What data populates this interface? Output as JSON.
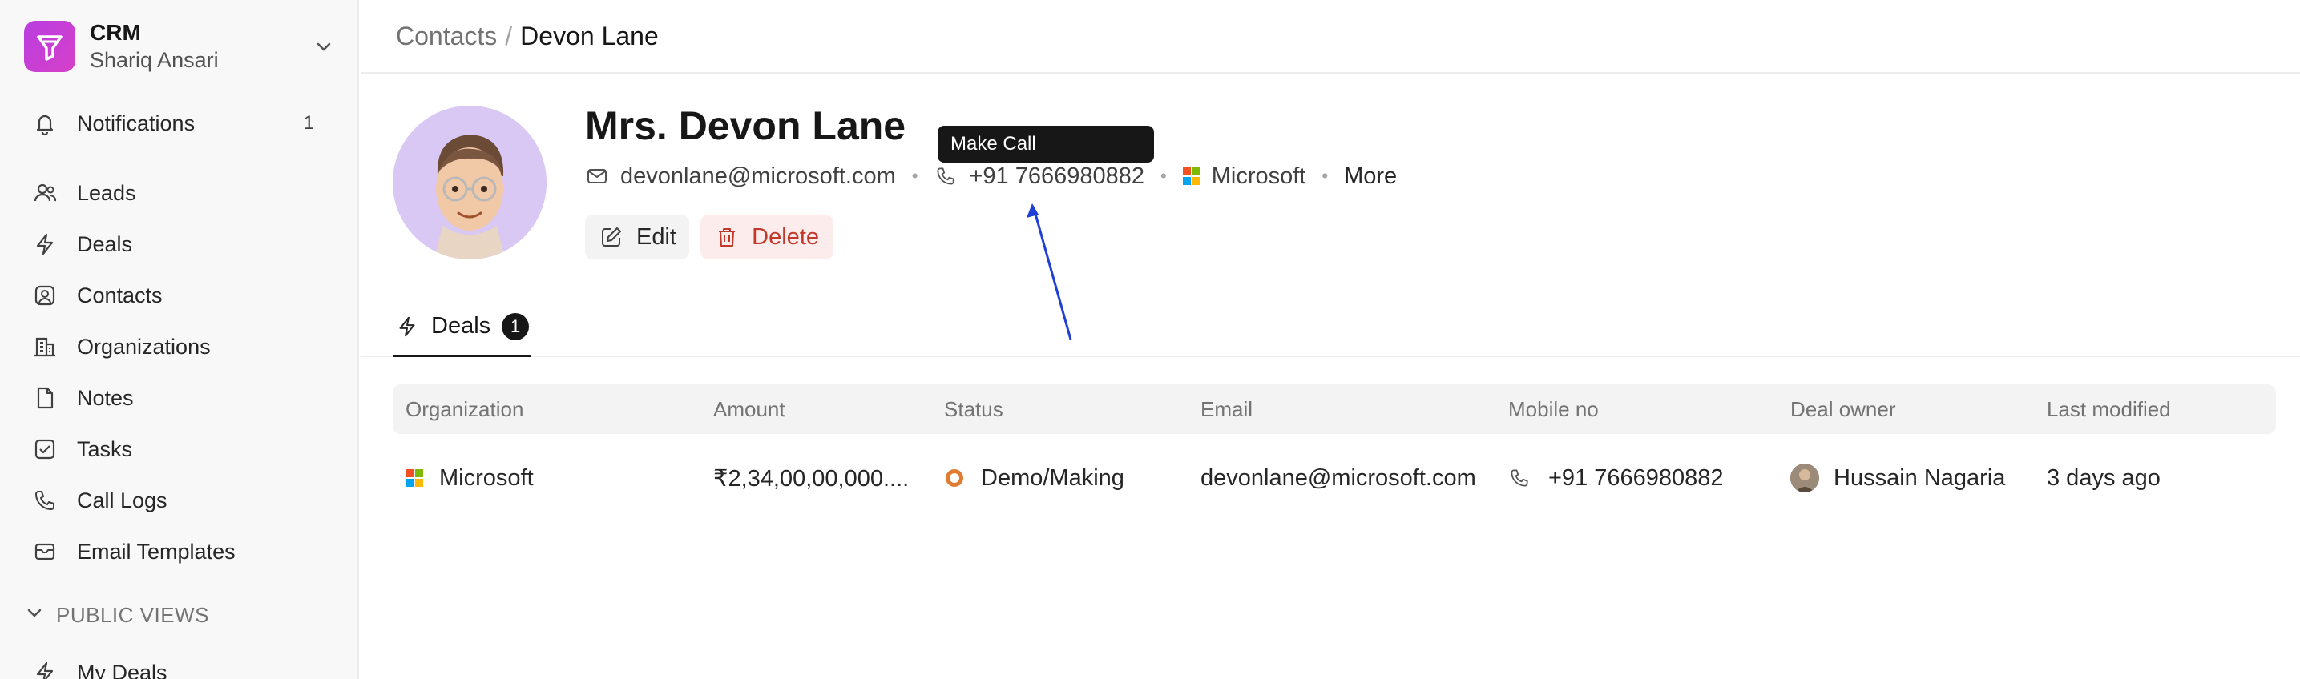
{
  "sidebar": {
    "app_name": "CRM",
    "user_name": "Shariq Ansari",
    "notifications": {
      "label": "Notifications",
      "count": "1"
    },
    "items": [
      {
        "label": "Leads",
        "icon": "users-icon"
      },
      {
        "label": "Deals",
        "icon": "lightning-icon"
      },
      {
        "label": "Contacts",
        "icon": "contact-icon"
      },
      {
        "label": "Organizations",
        "icon": "building-icon"
      },
      {
        "label": "Notes",
        "icon": "note-icon"
      },
      {
        "label": "Tasks",
        "icon": "checkbox-icon"
      },
      {
        "label": "Call Logs",
        "icon": "phone-icon"
      },
      {
        "label": "Email Templates",
        "icon": "mail-icon"
      }
    ],
    "section_label": "PUBLIC VIEWS",
    "section_items": [
      {
        "label": "My Deals",
        "icon": "lightning-icon"
      }
    ]
  },
  "breadcrumb": {
    "parent": "Contacts",
    "separator": "/",
    "current": "Devon Lane"
  },
  "contact": {
    "name": "Mrs. Devon Lane",
    "email": "devonlane@microsoft.com",
    "phone": "+91 7666980882",
    "organization": "Microsoft",
    "more_label": "More"
  },
  "tooltip": {
    "text": "Make Call"
  },
  "actions": {
    "edit_label": "Edit",
    "delete_label": "Delete"
  },
  "tabs": [
    {
      "label": "Deals",
      "count": "1"
    }
  ],
  "table": {
    "columns": [
      "Organization",
      "Amount",
      "Status",
      "Email",
      "Mobile no",
      "Deal owner",
      "Last modified"
    ],
    "rows": [
      {
        "organization": "Microsoft",
        "amount": "₹2,34,00,00,000....",
        "status": "Demo/Making",
        "email": "devonlane@microsoft.com",
        "mobile": "+91 7666980882",
        "owner": "Hussain Nagaria",
        "modified": "3 days ago"
      }
    ]
  },
  "colors": {
    "accent_logo": "#c23fd8",
    "delete_red": "#c0392b",
    "status_orange": "#e07b32",
    "annotation_arrow": "#1f3fd6"
  }
}
